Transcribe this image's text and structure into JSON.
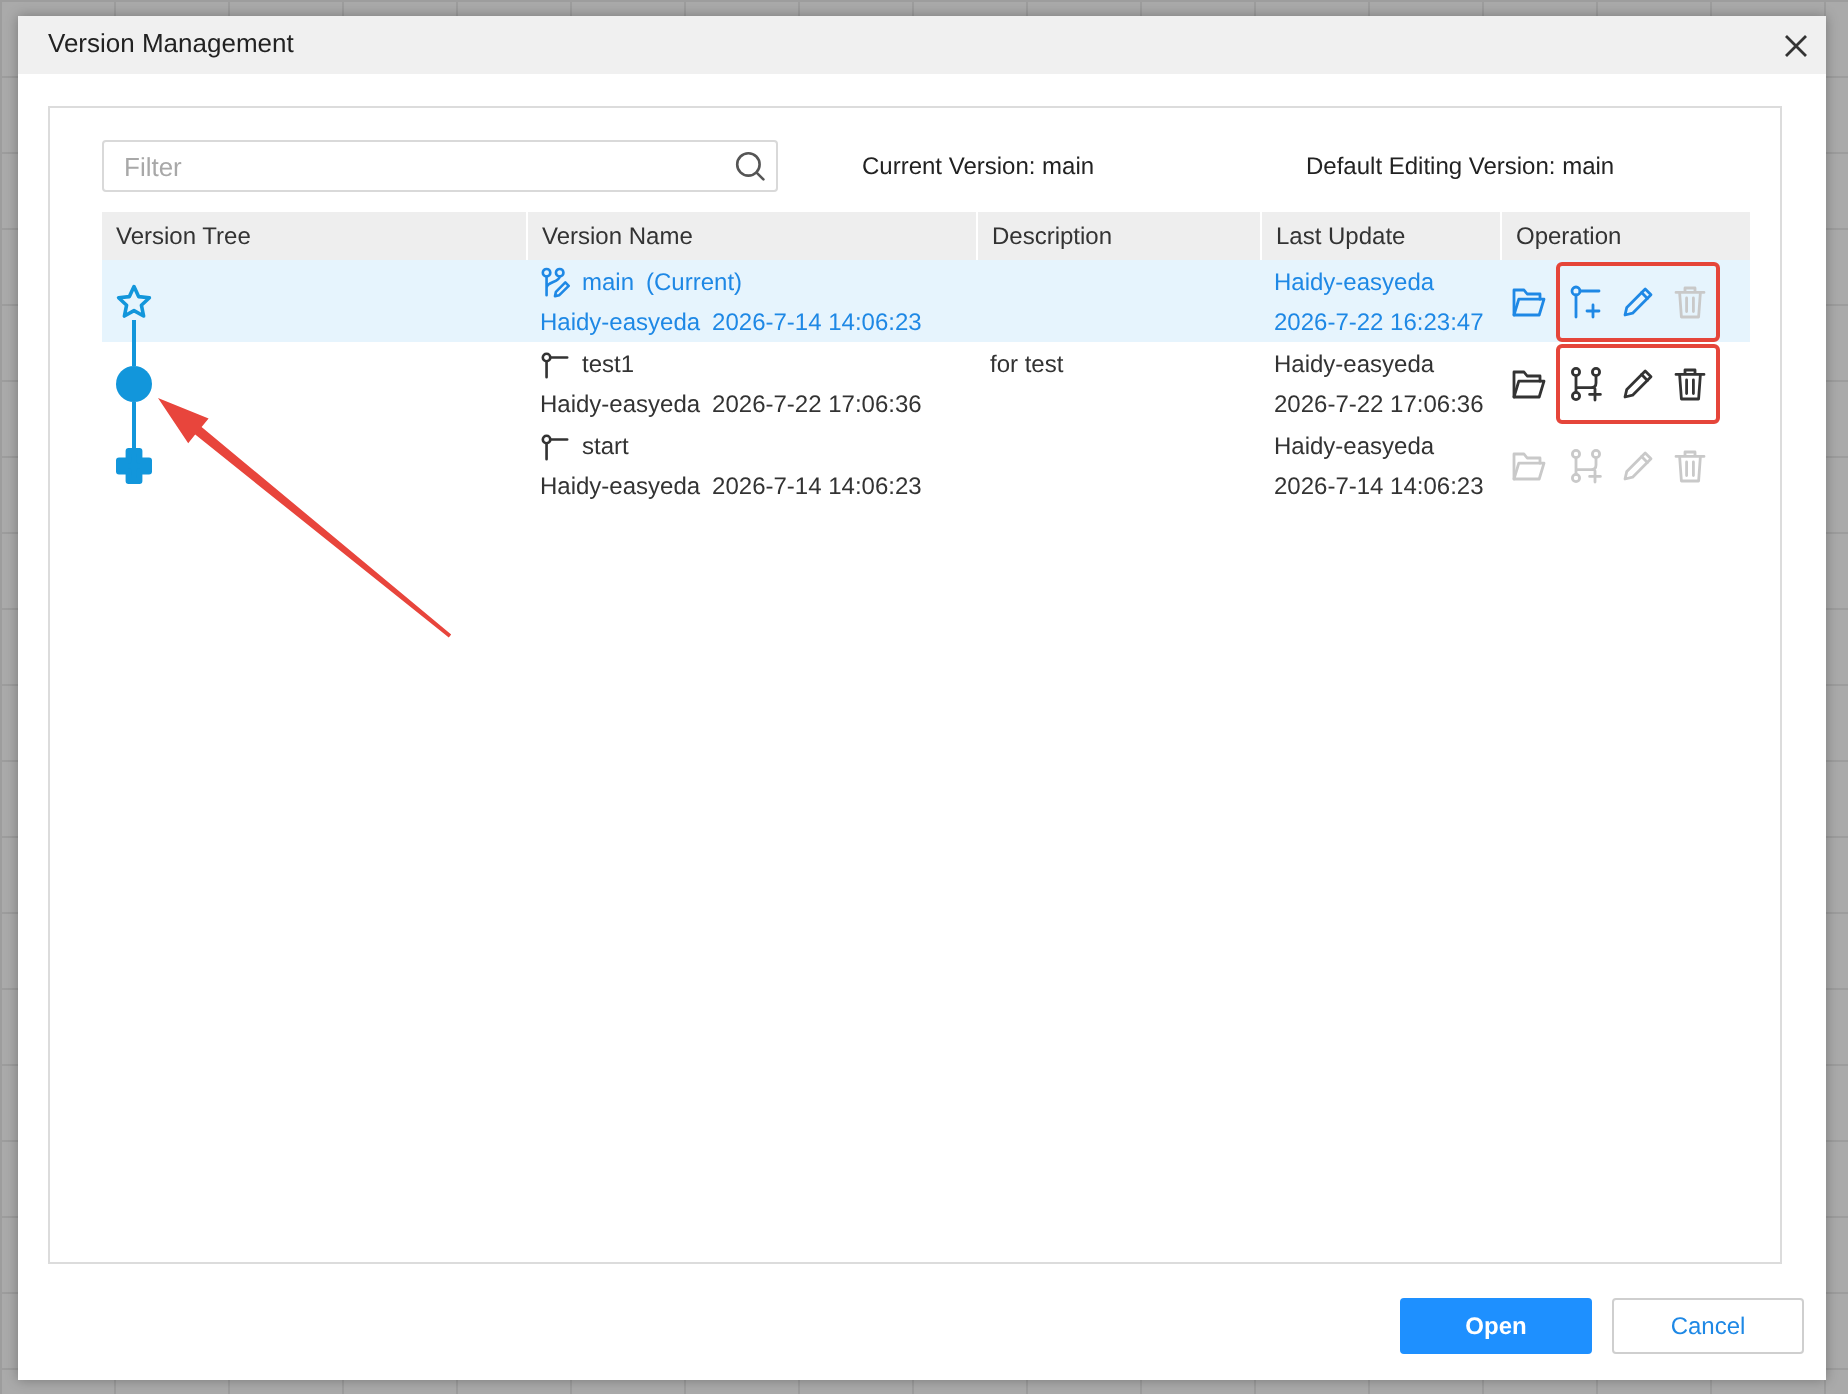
{
  "dialog": {
    "title": "Version Management"
  },
  "filter": {
    "placeholder": "Filter"
  },
  "info": [
    "Current Version: main",
    "Default Editing Version: main"
  ],
  "table": {
    "columns": [
      "Version Tree",
      "Version Name",
      "Description",
      "Last Update",
      "Operation"
    ],
    "rows": [
      {
        "kind": "current",
        "selected": true,
        "arrow": false,
        "name": "main",
        "tag": "(Current)",
        "author": "Haidy-easyeda",
        "created": "2026-7-14 14:06:23",
        "updated_by": "Haidy-easyeda",
        "updated": "2026-7-22 16:23:47",
        "open": {
          "disabled": false
        },
        "actions": [
          {
            "kind": "branch",
            "disabled": false
          },
          {
            "kind": "edit",
            "disabled": false
          },
          {
            "kind": "delete",
            "disabled": true
          }
        ],
        "framed": true
      },
      {
        "kind": "version",
        "selected": false,
        "arrow": true,
        "name": "test1",
        "author": "Haidy-easyeda",
        "created": "2026-7-22 17:06:36",
        "description": "for test",
        "updated_by": "Haidy-easyeda",
        "updated": "2026-7-22 17:06:36",
        "open": {
          "disabled": false
        },
        "actions": [
          {
            "kind": "fork",
            "disabled": false
          },
          {
            "kind": "edit",
            "disabled": false
          },
          {
            "kind": "delete",
            "disabled": false
          }
        ],
        "framed": true
      },
      {
        "kind": "root",
        "selected": false,
        "arrow": false,
        "name": "start",
        "author": "Haidy-easyeda",
        "created": "2026-7-14 14:06:23",
        "updated_by": "Haidy-easyeda",
        "updated": "2026-7-14 14:06:23",
        "open": {
          "disabled": true
        },
        "actions": [
          {
            "kind": "fork",
            "disabled": true
          },
          {
            "kind": "edit",
            "disabled": true
          },
          {
            "kind": "delete",
            "disabled": true
          }
        ],
        "framed": false
      }
    ]
  },
  "buttons": [
    {
      "label": "Open",
      "kind": "primary"
    },
    {
      "label": "Cancel",
      "kind": "secondary"
    }
  ]
}
